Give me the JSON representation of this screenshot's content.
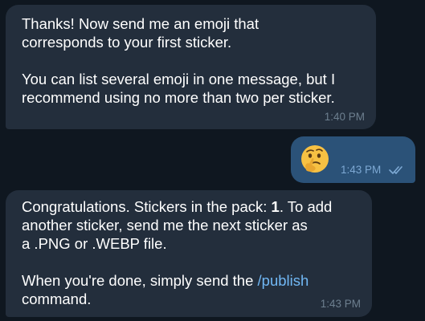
{
  "messages": [
    {
      "direction": "incoming",
      "paragraphs": [
        [
          "Thanks! Now send me an emoji that",
          "corresponds to your first sticker."
        ],
        [
          "You can list several emoji in one message, but I",
          "recommend using no more than two per sticker."
        ]
      ],
      "time": "1:40 PM"
    },
    {
      "direction": "outgoing",
      "emoji_icon": "thinking-face-icon",
      "time": "1:43 PM",
      "status": "read-double-check"
    },
    {
      "direction": "incoming",
      "p1": {
        "line1_pre": "Congratulations. Stickers in the pack: ",
        "count": "1",
        "line1_post": ". To add",
        "line2": "another sticker, send me the next sticker as",
        "line3": "a .PNG or .WEBP file."
      },
      "p2": {
        "line1_pre": "When you're done, simply send the ",
        "command": "/publish",
        "line2": "command."
      },
      "time": "1:43 PM"
    }
  ],
  "colors": {
    "background": "#0f1720",
    "incoming_bubble": "#232e3c",
    "outgoing_bubble": "#2b5278",
    "link": "#71b8f5",
    "timestamp": "#6d7f8f",
    "outgoing_timestamp": "#7da8d3"
  }
}
